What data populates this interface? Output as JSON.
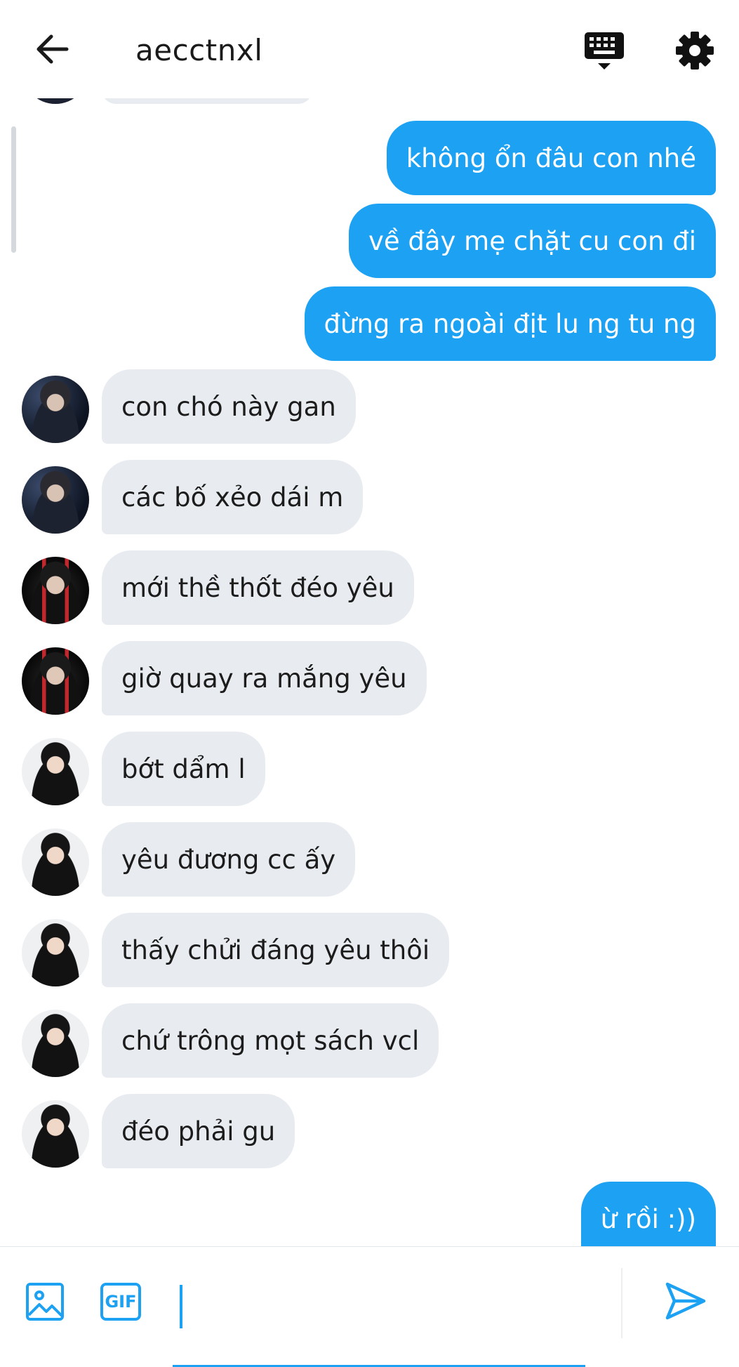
{
  "header": {
    "title": "aecctnxl",
    "back_icon": "arrow-left-icon",
    "keyboard_icon": "keyboard-icon",
    "settings_icon": "gear-icon"
  },
  "messages": [
    {
      "direction": "out",
      "text": "không ổn đâu con nhé"
    },
    {
      "direction": "out",
      "text": "về đây mẹ chặt cu con đi"
    },
    {
      "direction": "out",
      "text": "đừng ra ngoài địt lu ng tu ng"
    },
    {
      "direction": "in",
      "text": "con chó này gan",
      "avatar": "avatar-1"
    },
    {
      "direction": "in",
      "text": "các bố xẻo dái m",
      "avatar": "avatar-1"
    },
    {
      "direction": "in",
      "text": "mới thề thốt đéo yêu",
      "avatar": "avatar-2"
    },
    {
      "direction": "in",
      "text": "giờ quay ra mắng yêu",
      "avatar": "avatar-2"
    },
    {
      "direction": "in",
      "text": "bớt dẩm l",
      "avatar": "avatar-3"
    },
    {
      "direction": "in",
      "text": "yêu đương cc ấy",
      "avatar": "avatar-3"
    },
    {
      "direction": "in",
      "text": "thấy chửi đáng yêu thôi",
      "avatar": "avatar-3"
    },
    {
      "direction": "in",
      "text": "chứ trông mọt sách vcl",
      "avatar": "avatar-3"
    },
    {
      "direction": "in",
      "text": "đéo phải gu",
      "avatar": "avatar-3"
    },
    {
      "direction": "out",
      "text": "ừ rồi :))"
    }
  ],
  "composer": {
    "image_icon": "image-icon",
    "gif_label": "GIF",
    "input_value": "",
    "send_icon": "send-icon"
  },
  "colors": {
    "accent": "#1da1f2",
    "incoming_bubble": "#e8ecf0",
    "background": "#ffffff"
  }
}
